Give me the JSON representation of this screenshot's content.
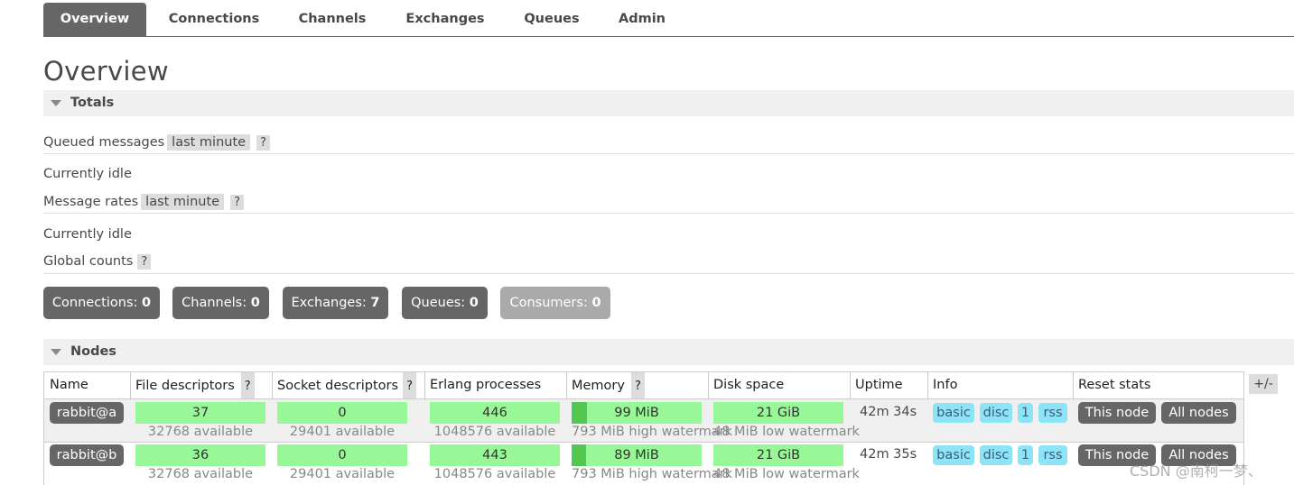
{
  "nav": {
    "tabs": [
      {
        "label": "Overview",
        "active": true
      },
      {
        "label": "Connections"
      },
      {
        "label": "Channels"
      },
      {
        "label": "Exchanges"
      },
      {
        "label": "Queues"
      },
      {
        "label": "Admin"
      }
    ]
  },
  "page_title": "Overview",
  "totals": {
    "section_title": "Totals",
    "queued_label": "Queued messages",
    "queued_range": "last minute",
    "help": "?",
    "queued_status": "Currently idle",
    "rates_label": "Message rates",
    "rates_range": "last minute",
    "rates_status": "Currently idle",
    "global_label": "Global counts"
  },
  "counts": [
    {
      "label": "Connections:",
      "value": "0"
    },
    {
      "label": "Channels:",
      "value": "0"
    },
    {
      "label": "Exchanges:",
      "value": "7"
    },
    {
      "label": "Queues:",
      "value": "0"
    },
    {
      "label": "Consumers:",
      "value": "0"
    }
  ],
  "nodes": {
    "section_title": "Nodes",
    "headers": [
      "Name",
      "File descriptors",
      "Socket descriptors",
      "Erlang processes",
      "Memory",
      "Disk space",
      "Uptime",
      "Info",
      "Reset stats"
    ],
    "help": "?",
    "toggle_columns": "+/-",
    "rows": [
      {
        "name": "rabbit@a",
        "fd": "37",
        "fd_avail": "32768 available",
        "sd": "0",
        "sd_avail": "29401 available",
        "ep": "446",
        "ep_avail": "1048576 available",
        "mem": "99 MiB",
        "mem_note": "793 MiB high watermark",
        "mem_fraction": 0.12,
        "disk": "21 GiB",
        "disk_note": "48 MiB low watermark",
        "uptime": "42m 34s",
        "info": [
          "basic",
          "disc",
          "1",
          "rss"
        ],
        "reset_this": "This node",
        "reset_all": "All nodes"
      },
      {
        "name": "rabbit@b",
        "fd": "36",
        "fd_avail": "32768 available",
        "sd": "0",
        "sd_avail": "29401 available",
        "ep": "443",
        "ep_avail": "1048576 available",
        "mem": "89 MiB",
        "mem_note": "793 MiB high watermark",
        "mem_fraction": 0.11,
        "disk": "21 GiB",
        "disk_note": "48 MiB low watermark",
        "uptime": "42m 35s",
        "info": [
          "basic",
          "disc",
          "1",
          "rss"
        ],
        "reset_this": "This node",
        "reset_all": "All nodes"
      }
    ]
  },
  "watermark": "CSDN @南柯一梦、"
}
